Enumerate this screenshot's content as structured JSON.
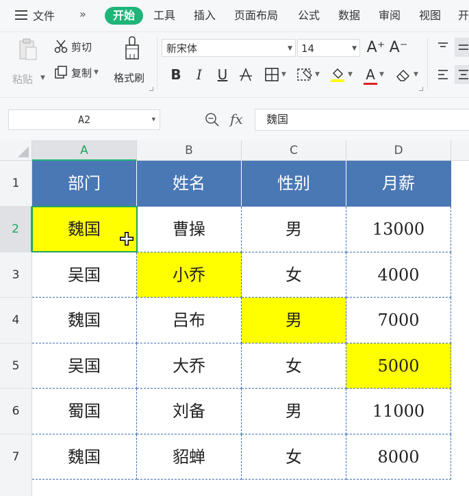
{
  "menu": {
    "file_label": "文件",
    "more_label": "»",
    "tabs": [
      {
        "label": "开始",
        "active": true
      },
      {
        "label": "工具"
      },
      {
        "label": "插入"
      },
      {
        "label": "页面布局"
      },
      {
        "label": "公式"
      },
      {
        "label": "数据"
      },
      {
        "label": "审阅"
      },
      {
        "label": "视图"
      },
      {
        "label": "开"
      }
    ]
  },
  "ribbon": {
    "paste_label": "粘贴",
    "cut_label": "剪切",
    "copy_label": "复制",
    "format_painter_label": "格式刷",
    "font_name": "新宋体",
    "font_size": "14",
    "bold": "B",
    "italic": "I",
    "underline": "U",
    "font_color_letter": "A",
    "grow_font": "A⁺",
    "shrink_font": "A⁻",
    "highlight_color": "#ffff00",
    "font_color": "#e02020"
  },
  "formula_bar": {
    "name_box": "A2",
    "fx_label": "fx",
    "content": "魏国"
  },
  "sheet": {
    "columns": [
      "A",
      "B",
      "C",
      "D"
    ],
    "selected_column": "A",
    "selected_row": "2",
    "header_row_label": "1",
    "headers": [
      "部门",
      "姓名",
      "性别",
      "月薪"
    ],
    "header_color": "#4a78b5",
    "rows": [
      {
        "label": "2",
        "cells": [
          "魏国",
          "曹操",
          "男",
          "13000"
        ],
        "highlight": 0
      },
      {
        "label": "3",
        "cells": [
          "吴国",
          "小乔",
          "女",
          "4000"
        ],
        "highlight": 1
      },
      {
        "label": "4",
        "cells": [
          "魏国",
          "吕布",
          "男",
          "7000"
        ],
        "highlight": 2
      },
      {
        "label": "5",
        "cells": [
          "吴国",
          "大乔",
          "女",
          "5000"
        ],
        "highlight": 3
      },
      {
        "label": "6",
        "cells": [
          "蜀国",
          "刘备",
          "男",
          "11000"
        ],
        "highlight": -1
      },
      {
        "label": "7",
        "cells": [
          "魏国",
          "貂蝉",
          "女",
          "8000"
        ],
        "highlight": -1
      }
    ],
    "highlight_color": "#ffff00",
    "active_cell": "A2"
  }
}
